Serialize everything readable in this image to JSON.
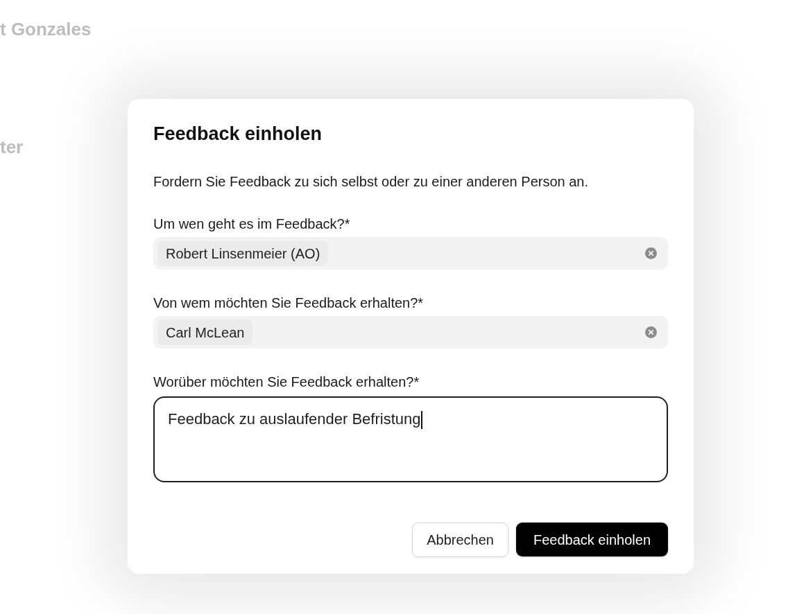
{
  "background": {
    "texts": [
      "t Gonzales",
      "ter"
    ]
  },
  "dialog": {
    "title": "Feedback einholen",
    "description": "Fordern Sie Feedback zu sich selbst oder zu einer anderen Person an.",
    "fields": [
      {
        "kind": "chips",
        "label": "Um wen geht es im Feedback?*",
        "chips": [
          "Robert Linsenmeier (AO)"
        ]
      },
      {
        "kind": "chips",
        "label": "Von wem möchten Sie Feedback erhalten?*",
        "chips": [
          "Carl McLean"
        ]
      },
      {
        "kind": "textarea",
        "label": "Worüber möchten Sie Feedback erhalten?*",
        "value": "Feedback zu auslaufender Befristung",
        "focused": true
      }
    ],
    "buttons": [
      {
        "kind": "secondary",
        "label": "Abbrechen"
      },
      {
        "kind": "primary",
        "label": "Feedback einholen"
      }
    ]
  }
}
